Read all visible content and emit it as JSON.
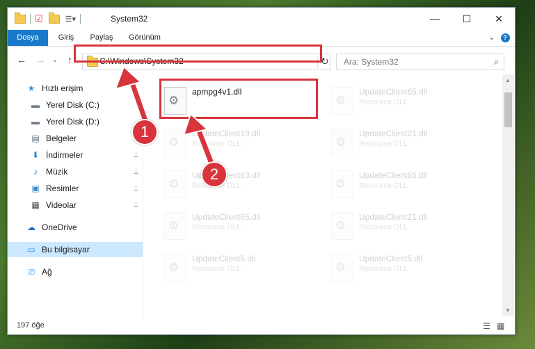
{
  "window": {
    "title": "System32",
    "minimize": "—",
    "maximize": "☐",
    "close": "✕"
  },
  "ribbon": {
    "tabs": [
      "Dosya",
      "Giriş",
      "Paylaş",
      "Görünüm"
    ],
    "expand": "⌄",
    "help": "?"
  },
  "nav": {
    "back": "←",
    "forward": "→",
    "recent": "⌄",
    "up": "↑",
    "address": "C:\\Windows\\System32",
    "address_dropdown": "⌄",
    "refresh": "↻",
    "search_placeholder": "Ara: System32",
    "search_icon": "⌕"
  },
  "sidebar": {
    "items": [
      {
        "label": "Hızlı erişim",
        "icon": "star-icon",
        "glyph": "★",
        "color": "#3a8fd8",
        "pinned": false
      },
      {
        "label": "Yerel Disk (C:)",
        "icon": "drive-icon",
        "glyph": "▬",
        "color": "#6d7a86",
        "pinned": false
      },
      {
        "label": "Yerel Disk (D:)",
        "icon": "drive-icon",
        "glyph": "▬",
        "color": "#6d7a86",
        "pinned": false
      },
      {
        "label": "Belgeler",
        "icon": "documents-icon",
        "glyph": "▤",
        "color": "#5a6a7a",
        "pinned": true
      },
      {
        "label": "İndirmeler",
        "icon": "download-icon",
        "glyph": "⬇",
        "color": "#2c7fd4",
        "pinned": true
      },
      {
        "label": "Müzik",
        "icon": "music-icon",
        "glyph": "♪",
        "color": "#2c7fd4",
        "pinned": true
      },
      {
        "label": "Resimler",
        "icon": "pictures-icon",
        "glyph": "▣",
        "color": "#3c8cc8",
        "pinned": true
      },
      {
        "label": "Videolar",
        "icon": "video-icon",
        "glyph": "▦",
        "color": "#444",
        "pinned": true
      },
      {
        "label": "OneDrive",
        "icon": "cloud-icon",
        "glyph": "☁",
        "color": "#1f6fc5",
        "pinned": false
      },
      {
        "label": "Bu bilgisayar",
        "icon": "computer-icon",
        "glyph": "▭",
        "color": "#2d8ad8",
        "pinned": false
      },
      {
        "label": "Ağ",
        "icon": "network-icon",
        "glyph": "⎚",
        "color": "#2d8ad8",
        "pinned": false
      }
    ],
    "pin_glyph": "📌"
  },
  "files": [
    {
      "name": "apmpg4v1.dll",
      "type": "",
      "ghost": false
    },
    {
      "name": "UpdateClient65.dll",
      "type": "Resource DLL",
      "ghost": true
    },
    {
      "name": "UpdateClient19.dll",
      "type": "Resource DLL",
      "ghost": true
    },
    {
      "name": "UpdateClient21.dll",
      "type": "Resource DLL",
      "ghost": true
    },
    {
      "name": "UpdateClient63.dll",
      "type": "Resource DLL",
      "ghost": true
    },
    {
      "name": "UpdateClient65.dll",
      "type": "Resource DLL",
      "ghost": true
    },
    {
      "name": "UpdateClient65.dll",
      "type": "Resource DLL",
      "ghost": true
    },
    {
      "name": "UpdateClient21.dll",
      "type": "Resource DLL",
      "ghost": true
    },
    {
      "name": "UpdateClient5.dll",
      "type": "Resource DLL",
      "ghost": true
    },
    {
      "name": "UpdateClient5.dll",
      "type": "Resource DLL",
      "ghost": true
    }
  ],
  "status": {
    "count": "197 öğe",
    "details_view": "☰",
    "tiles_view": "▦"
  },
  "annotations": {
    "step1": "1",
    "step2": "2",
    "highlight_color": "#d7343c"
  }
}
